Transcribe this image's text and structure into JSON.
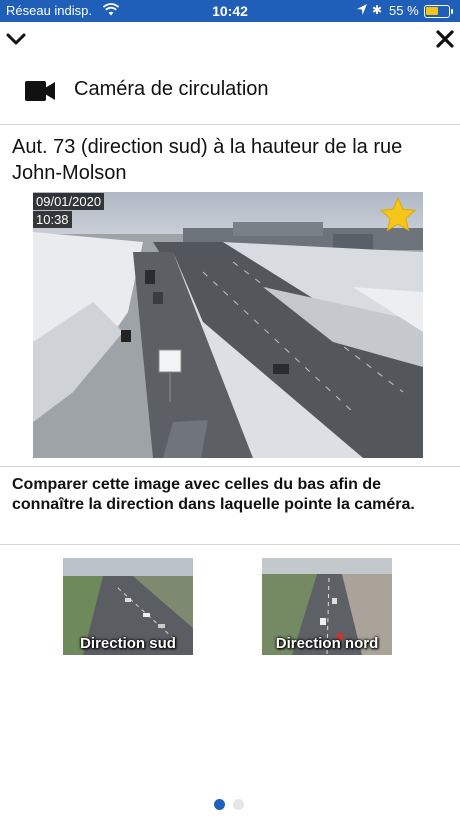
{
  "status_bar": {
    "carrier": "Réseau indisp.",
    "time": "10:42",
    "battery_percent": "55 %",
    "battery_level": 0.55
  },
  "nav": {
    "collapse_icon": "chevron-down-icon",
    "close_icon": "close-icon"
  },
  "header": {
    "icon": "video-camera-icon",
    "title": "Caméra de circulation"
  },
  "location": {
    "title": "Aut. 73 (direction sud) à la hauteur de la rue John-Molson"
  },
  "camera": {
    "date": "09/01/2020",
    "time": "10:38",
    "favorite_icon": "star-icon",
    "favorite": true
  },
  "instructions": "Comparer cette image avec celles du bas afin de connaître la direction dans laquelle pointe la caméra.",
  "thumbnails": [
    {
      "label": "Direction sud"
    },
    {
      "label": "Direction nord"
    }
  ],
  "pagination": {
    "current": 1,
    "total": 2
  },
  "colors": {
    "status_bar": "#1f5fb8",
    "star": "#f5c518",
    "dot_active": "#1f5fb8"
  }
}
